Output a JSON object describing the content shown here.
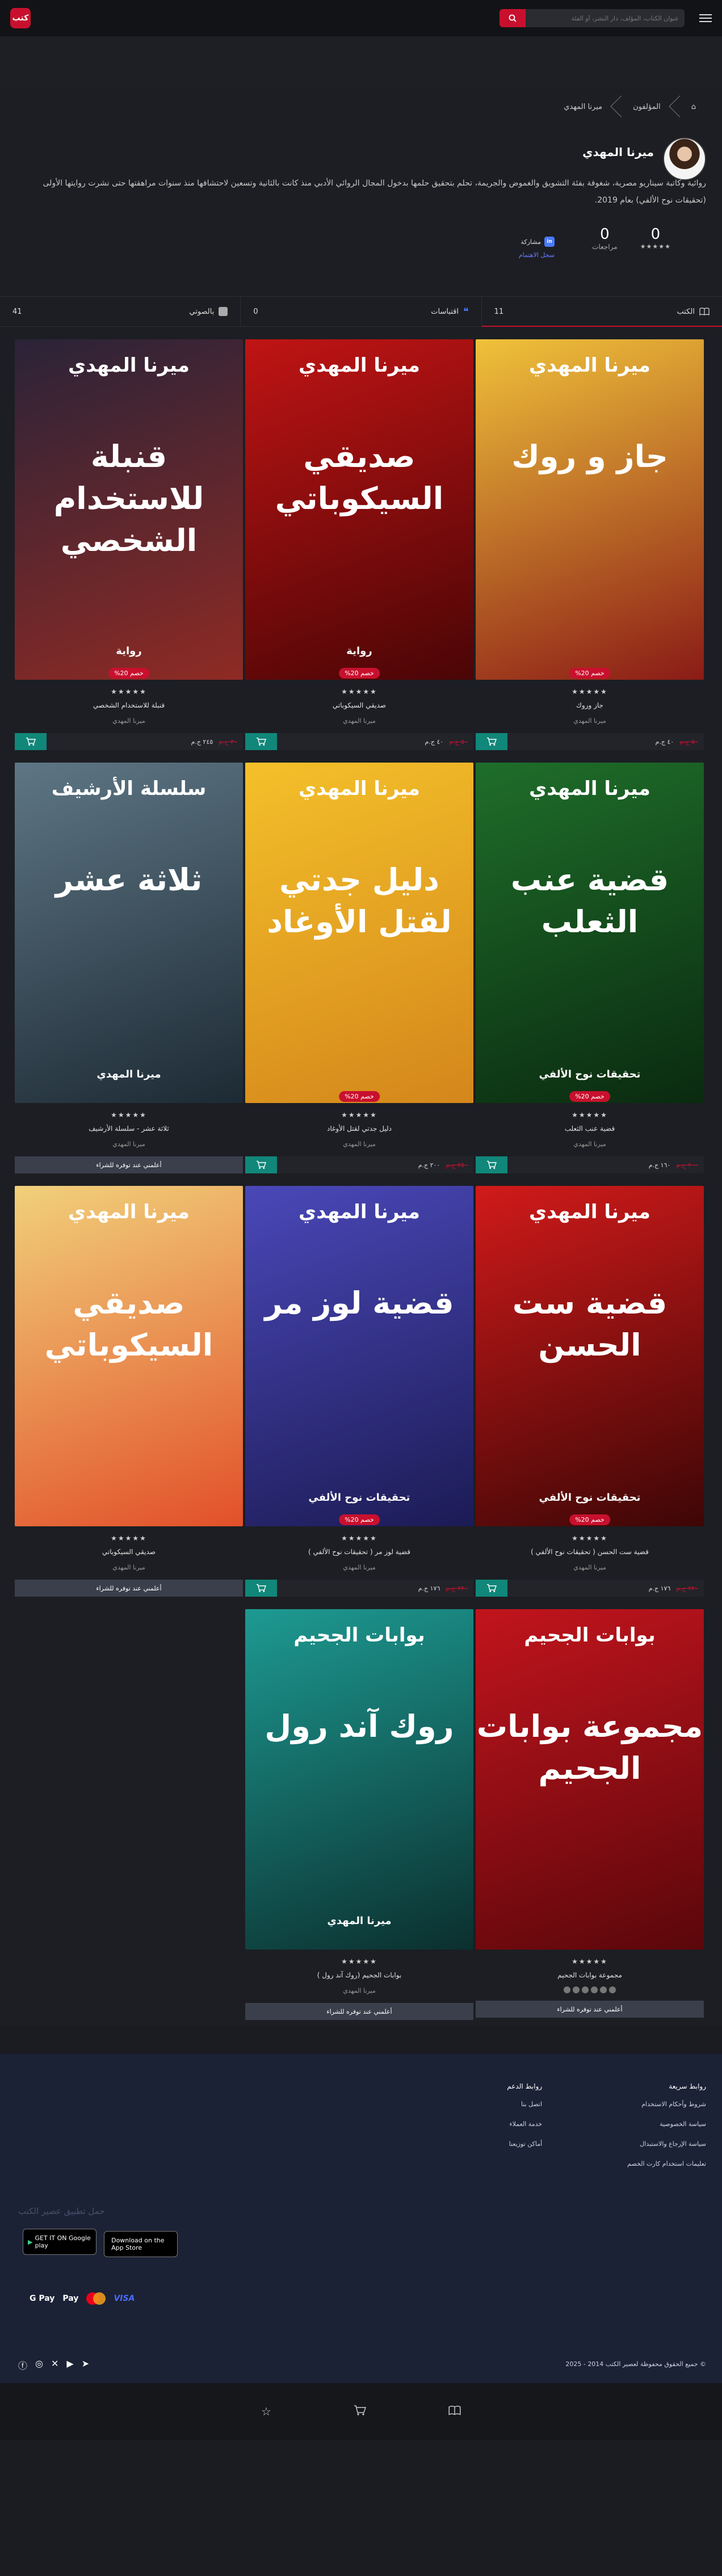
{
  "header": {
    "logo_text": "كتب",
    "search_placeholder": "عنوان الكتاب، المؤلف، دار النشر، أو الفئة"
  },
  "breadcrumb": {
    "home": "⌂",
    "authors": "المؤلفون",
    "current": "ميرنا المهدي"
  },
  "author": {
    "name": "ميرنا المهدي",
    "bio": "روائية وكاتبة سيناريو مصرية، شغوفة بفئة التشويق والغموض والجريمة، تحلم بتحقيق حلمها بدخول المجال الروائي الأدبي منذ كانت بالثانية وتسعين لاحتشافها منذ سنوات مراهقتها حتى نشرت روايتها الأولى (تحقيقات نوح الألفي) بعام 2019.",
    "rating_value": "0",
    "reviews_count": "0",
    "reviews_label": "مراجعات",
    "share_label": "مشاركة",
    "share_link": "سجل الاهتمام"
  },
  "tabs": [
    {
      "label": "الكتب",
      "count": "11"
    },
    {
      "label": "اقتباسات",
      "count": "0"
    },
    {
      "label": "بالصوتي",
      "count": "41"
    }
  ],
  "books": [
    {
      "title": "جاز وروك",
      "author": "ميرنا المهدي",
      "stars": "★★★★★",
      "discount": "خصم 20%",
      "old_price": "٥٠ ج.م",
      "new_price": "٤٠ ج.م",
      "available": true,
      "cover_author": "ميرنا المهدي",
      "cover_title": "جاز و روك",
      "cover_sub": "",
      "c1": "#f0c23a",
      "c2": "#8a1b16"
    },
    {
      "title": "صديقي السيكوباتي",
      "author": "ميرنا المهدي",
      "stars": "★★★★★",
      "discount": "خصم 20%",
      "old_price": "٥٠ ج.م",
      "new_price": "٤٠ ج.م",
      "available": true,
      "cover_author": "ميرنا المهدي",
      "cover_title": "صديقي السيكوباتي",
      "cover_sub": "رواية",
      "c1": "#c01414",
      "c2": "#4a0506"
    },
    {
      "title": "قنبلة للاستخدام الشخصي",
      "author": "ميرنا المهدي",
      "stars": "★★★★★",
      "discount": "خصم 20%",
      "old_price": "٣٠ ج.م",
      "new_price": "٢٤٥ ج.م",
      "available": true,
      "cover_author": "ميرنا المهدي",
      "cover_title": "قنبلة للاستخدام الشخصي",
      "cover_sub": "رواية",
      "c1": "#2a2338",
      "c2": "#8f2a24"
    },
    {
      "title": "قضية عنب الثعلب",
      "author": "ميرنا المهدي",
      "stars": "★★★★★",
      "discount": "خصم 20%",
      "old_price": "٢٠٠ ج.م",
      "new_price": "١٦٠ ج.م",
      "available": true,
      "cover_author": "ميرنا المهدي",
      "cover_title": "قضية عنب الثعلب",
      "cover_sub": "تحقيقات نوح الألفي",
      "c1": "#1f6e2a",
      "c2": "#0a2a10"
    },
    {
      "title": "دليل جدتي لقتل الأوغاد",
      "author": "ميرنا المهدي",
      "stars": "★★★★★",
      "discount": "خصم 20%",
      "old_price": "٢٥٠ ج.م",
      "new_price": "٢٠٠ ج.م",
      "available": true,
      "cover_author": "ميرنا المهدي",
      "cover_title": "دليل جدتي لقتل الأوغاد",
      "cover_sub": "",
      "c1": "#f4c02a",
      "c2": "#d4861b"
    },
    {
      "title": "ثلاثة عشر - سلسلة الأرشيف",
      "author": "ميرنا المهدي",
      "stars": "★★★★★",
      "discount": "",
      "old_price": "",
      "new_price": "",
      "available": false,
      "cover_author": "سلسلة الأرشيف",
      "cover_title": "ثلاثة عشر",
      "cover_sub": "ميرنا المهدي",
      "c1": "#5e7685",
      "c2": "#1d2a34"
    },
    {
      "title": "قضية ست الحسن ( تحقيقات نوح الألفي )",
      "author": "ميرنا المهدي",
      "stars": "★★★★★",
      "discount": "خصم 20%",
      "old_price": "٢٢٠ ج.م",
      "new_price": "١٧٦ ج.م",
      "available": true,
      "cover_author": "ميرنا المهدي",
      "cover_title": "قضية ست الحسن",
      "cover_sub": "تحقيقات نوح الألفي",
      "c1": "#d11a1a",
      "c2": "#3d0606"
    },
    {
      "title": "قضية لوز مر ( تحقيقات نوح الألفي )",
      "author": "ميرنا المهدي",
      "stars": "★★★★★",
      "discount": "خصم 20%",
      "old_price": "٢٢٠ ج.م",
      "new_price": "١٧٦ ج.م",
      "available": true,
      "cover_author": "ميرنا المهدي",
      "cover_title": "قضية لوز مر",
      "cover_sub": "تحقيقات نوح الألفي",
      "c1": "#4a48b8",
      "c2": "#1c1b55"
    },
    {
      "title": "صديقي السيكوباتي",
      "author": "ميرنا المهدي",
      "stars": "★★★★★",
      "discount": "",
      "old_price": "",
      "new_price": "",
      "available": false,
      "cover_author": "ميرنا المهدي",
      "cover_title": "صديقي السيكوباتي",
      "cover_sub": "",
      "c1": "#f1d07a",
      "c2": "#e2502a"
    },
    {
      "title": "مجموعة بوابات الجحيم",
      "author": "",
      "stars": "★★★★★",
      "discount": "",
      "old_price": "",
      "new_price": "",
      "available": false,
      "cover_author": "بوابات الجحيم",
      "cover_title": "مجموعة بوابات الجحيم",
      "cover_sub": "",
      "c1": "#c2141d",
      "c2": "#5a070b"
    },
    {
      "title": "بوابات الجحيم (روك آند رول )",
      "author": "ميرنا المهدي",
      "stars": "★★★★★",
      "discount": "",
      "old_price": "",
      "new_price": "",
      "available": false,
      "cover_author": "بوابات الجحيم",
      "cover_title": "روك آند رول",
      "cover_sub": "ميرنا المهدي",
      "c1": "#1d9a92",
      "c2": "#0b2f2e"
    }
  ],
  "notify_label": "أعلمني عند توفره للشراء",
  "footer": {
    "quick_links_title": "روابط سريعة",
    "quick_links": [
      "شروط وأحكام الاستخدام",
      "سياسة الخصوصية",
      "سياسة الإرجاع والاستبدال",
      "تعليمات استخدام كارت الخصم"
    ],
    "support_title": "روابط الدعم",
    "support_links": [
      "اتصل بنا",
      "خدمة العملاء",
      "أماكن توزيعنا"
    ],
    "apps_title": "حمل تطبيق عصير الكتب",
    "google_play": "GET IT ON Google play",
    "app_store": "Download on the App Store",
    "pay_gpay": "G Pay",
    "pay_apay": " Pay",
    "pay_visa": "VISA",
    "copyright": "© جميع الحقوق محفوظة لعصير الكتب 2014 - 2025"
  }
}
